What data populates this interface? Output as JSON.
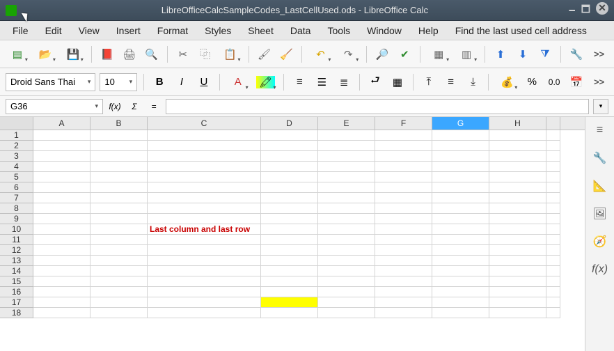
{
  "window": {
    "title": "LibreOfficeCalcSampleCodes_LastCellUsed.ods - LibreOffice Calc"
  },
  "menubar": {
    "items": [
      "File",
      "Edit",
      "View",
      "Insert",
      "Format",
      "Styles",
      "Sheet",
      "Data",
      "Tools",
      "Window",
      "Help",
      "Find the last used cell address"
    ]
  },
  "toolbar2": {
    "font_name": "Droid Sans Thai",
    "font_size": "10",
    "percent_label": "%",
    "number_sample": "0.0"
  },
  "formula_bar": {
    "cell_ref": "G36",
    "fx_label": "f(x)",
    "sum_label": "Σ",
    "eq_label": "=",
    "formula_value": ""
  },
  "grid": {
    "columns": [
      "A",
      "B",
      "C",
      "D",
      "E",
      "F",
      "G",
      "H"
    ],
    "selected_column": "G",
    "row_count": 18,
    "content": {
      "C10": "Last column and last row"
    },
    "highlighted_cell": "D17"
  },
  "overflow_label": ">>"
}
